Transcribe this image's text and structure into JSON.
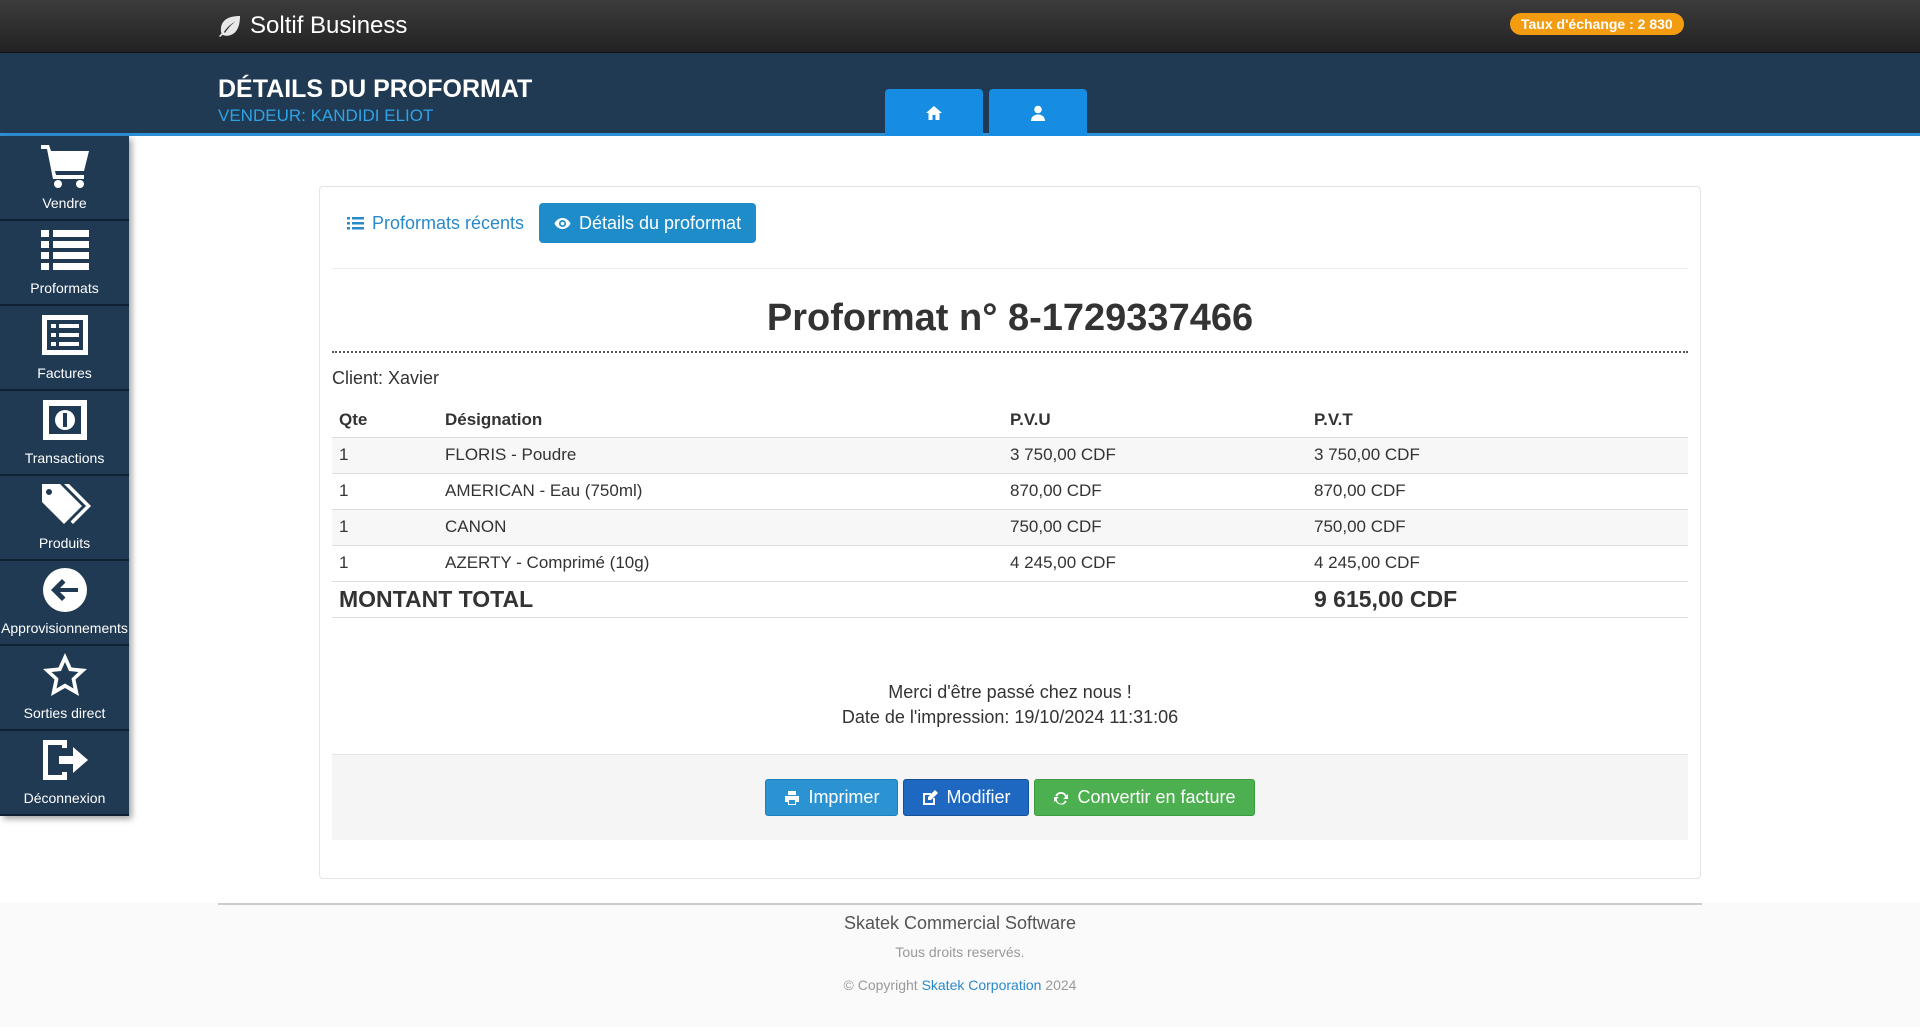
{
  "app": {
    "brand": "Soltif Business",
    "exchange_rate": "Taux d'échange : 2 830"
  },
  "header": {
    "title": "DÉTAILS DU PROFORMAT",
    "subtitle": "VENDEUR: KANDIDI ELIOT",
    "tabs": [
      {
        "icon": "home-icon"
      },
      {
        "icon": "user-icon"
      }
    ]
  },
  "sidebar": {
    "items": [
      {
        "label": "Vendre",
        "icon": "cart-icon"
      },
      {
        "label": "Proformats",
        "icon": "list-icon"
      },
      {
        "label": "Factures",
        "icon": "invoice-icon"
      },
      {
        "label": "Transactions",
        "icon": "money-icon"
      },
      {
        "label": "Produits",
        "icon": "tags-icon"
      },
      {
        "label": "Approvisionnements",
        "icon": "arrow-left-circle-icon"
      },
      {
        "label": "Sorties direct",
        "icon": "star-icon"
      },
      {
        "label": "Déconnexion",
        "icon": "logout-icon"
      }
    ]
  },
  "tabs": {
    "recent": "Proformats récents",
    "details": "Détails du proformat"
  },
  "proforma": {
    "title": "Proformat n° 8-1729337466",
    "client": "Client: Xavier",
    "columns": {
      "qte": "Qte",
      "designation": "Désignation",
      "pvu": "P.V.U",
      "pvt": "P.V.T"
    },
    "rows": [
      {
        "qte": "1",
        "designation": "FLORIS - Poudre",
        "pvu": "3 750,00 CDF",
        "pvt": "3 750,00 CDF"
      },
      {
        "qte": "1",
        "designation": "AMERICAN - Eau (750ml)",
        "pvu": "870,00 CDF",
        "pvt": "870,00 CDF"
      },
      {
        "qte": "1",
        "designation": "CANON",
        "pvu": "750,00 CDF",
        "pvt": "750,00 CDF"
      },
      {
        "qte": "1",
        "designation": "AZERTY - Comprimé (10g)",
        "pvu": "4 245,00 CDF",
        "pvt": "4 245,00 CDF"
      }
    ],
    "total_label": "MONTANT TOTAL",
    "total_value": "9 615,00 CDF",
    "thanks": "Merci d'être passé chez nous !",
    "print_date": "Date de l'impression: 19/10/2024 11:31:06"
  },
  "actions": {
    "print": "Imprimer",
    "edit": "Modifier",
    "convert": "Convertir en facture"
  },
  "footer": {
    "title": "Skatek Commercial Software",
    "rights": "Tous droits reservés.",
    "copy_prefix": "© Copyright",
    "company": "Skatek Corporation",
    "year": "2024"
  },
  "colors": {
    "header_bg": "#1f3a52",
    "accent": "#168de2",
    "badge": "#f39c12",
    "success": "#4caf50"
  }
}
